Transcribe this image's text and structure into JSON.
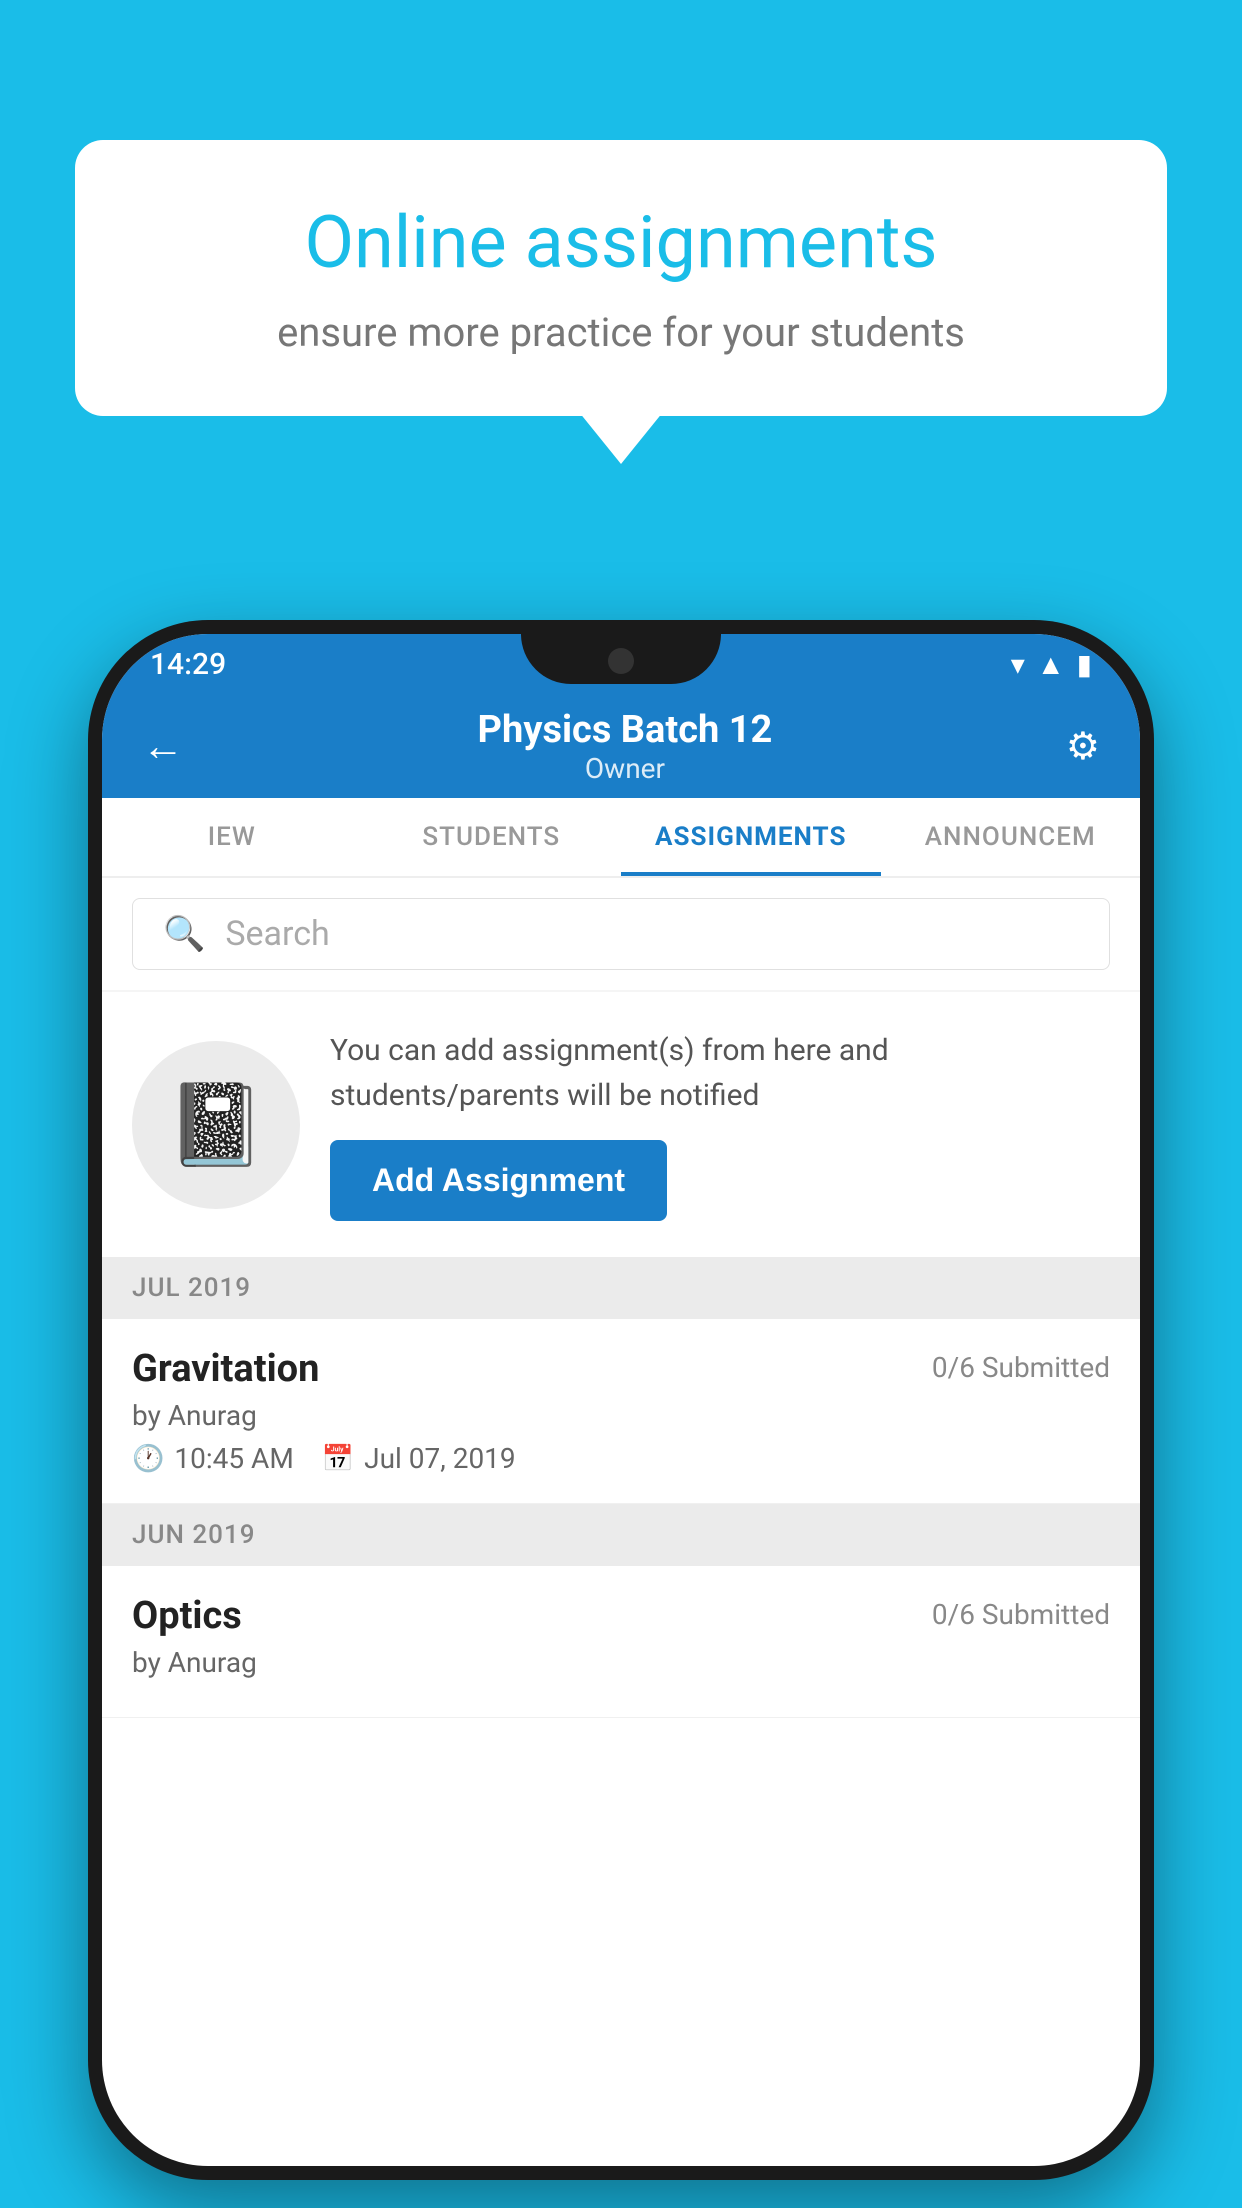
{
  "background_color": "#1ABDE8",
  "speech_bubble": {
    "title": "Online assignments",
    "subtitle": "ensure more practice for your students"
  },
  "status_bar": {
    "time": "14:29",
    "icons": [
      "wifi",
      "signal",
      "battery"
    ]
  },
  "app_header": {
    "title": "Physics Batch 12",
    "subtitle": "Owner",
    "back_label": "←",
    "settings_label": "⚙"
  },
  "tabs": [
    {
      "label": "IEW",
      "active": false
    },
    {
      "label": "STUDENTS",
      "active": false
    },
    {
      "label": "ASSIGNMENTS",
      "active": true
    },
    {
      "label": "ANNOUNCEM",
      "active": false
    }
  ],
  "search": {
    "placeholder": "Search"
  },
  "promo": {
    "text": "You can add assignment(s) from here and students/parents will be notified",
    "button_label": "Add Assignment"
  },
  "sections": [
    {
      "month": "JUL 2019",
      "assignments": [
        {
          "name": "Gravitation",
          "submitted": "0/6 Submitted",
          "author": "by Anurag",
          "time": "10:45 AM",
          "date": "Jul 07, 2019"
        }
      ]
    },
    {
      "month": "JUN 2019",
      "assignments": [
        {
          "name": "Optics",
          "submitted": "0/6 Submitted",
          "author": "by Anurag",
          "time": "",
          "date": ""
        }
      ]
    }
  ]
}
